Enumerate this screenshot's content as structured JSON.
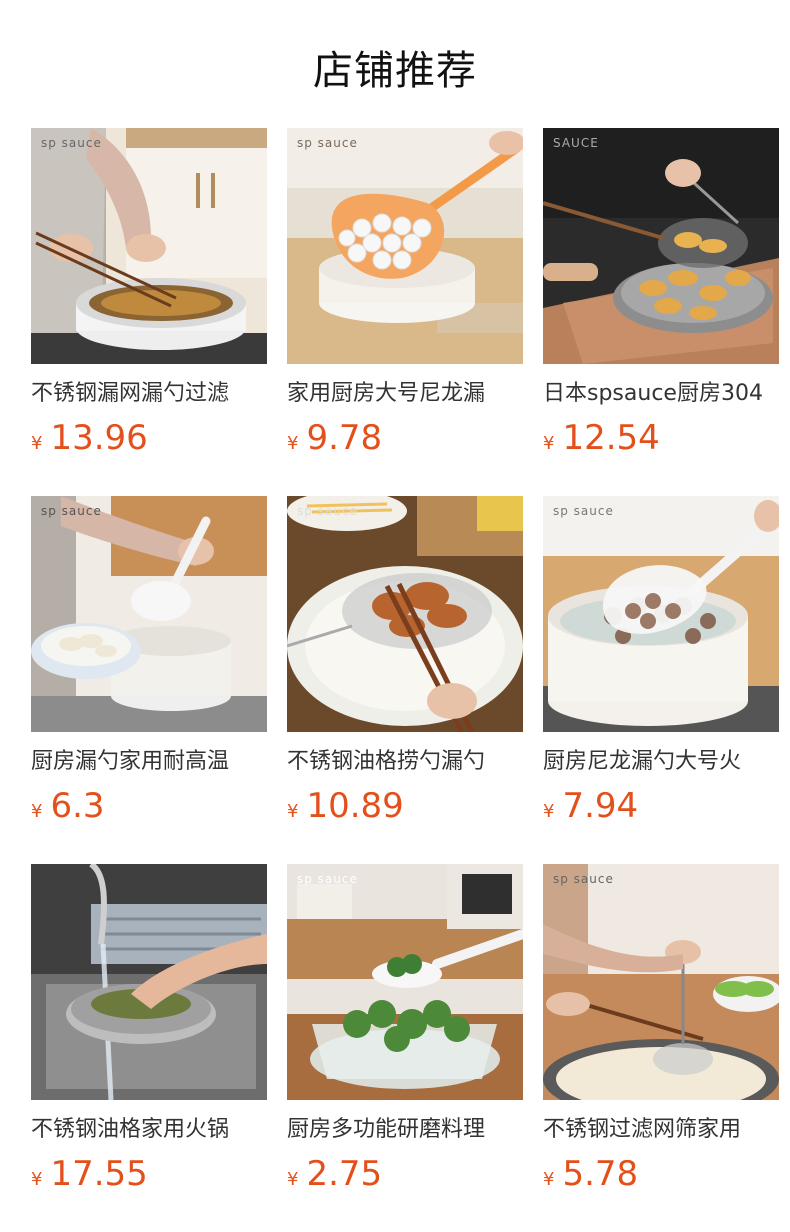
{
  "header": {
    "title": "店铺推荐"
  },
  "products": [
    {
      "name": "不锈钢漏网漏勺过滤",
      "currency": "¥",
      "price": "13.96",
      "brand": "sp sauce",
      "image": "fryer-basket-photo"
    },
    {
      "name": "家用厨房大号尼龙漏",
      "currency": "¥",
      "price": "9.78",
      "brand": "sp sauce",
      "image": "orange-colander-photo"
    },
    {
      "name": "日本spsauce厨房304",
      "currency": "¥",
      "price": "12.54",
      "brand": "SAUCE",
      "image": "mesh-strainer-fried-food-photo"
    },
    {
      "name": "厨房漏勺家用耐高温",
      "currency": "¥",
      "price": "6.3",
      "brand": "sp sauce",
      "image": "dumpling-ladle-photo"
    },
    {
      "name": "不锈钢油格捞勺漏勺",
      "currency": "¥",
      "price": "10.89",
      "brand": "sp sauce",
      "image": "oil-skimmer-photo"
    },
    {
      "name": "厨房尼龙漏勺大号火",
      "currency": "¥",
      "price": "7.94",
      "brand": "sp sauce",
      "image": "meatball-ladle-photo"
    },
    {
      "name": "不锈钢油格家用火锅",
      "currency": "¥",
      "price": "17.55",
      "brand": "",
      "image": "sink-strainer-photo"
    },
    {
      "name": "厨房多功能研磨料理",
      "currency": "¥",
      "price": "2.75",
      "brand": "sp sauce",
      "image": "broccoli-spoon-photo"
    },
    {
      "name": "不锈钢过滤网筛家用",
      "currency": "¥",
      "price": "5.78",
      "brand": "sp sauce",
      "image": "hotpot-strainer-photo"
    }
  ]
}
